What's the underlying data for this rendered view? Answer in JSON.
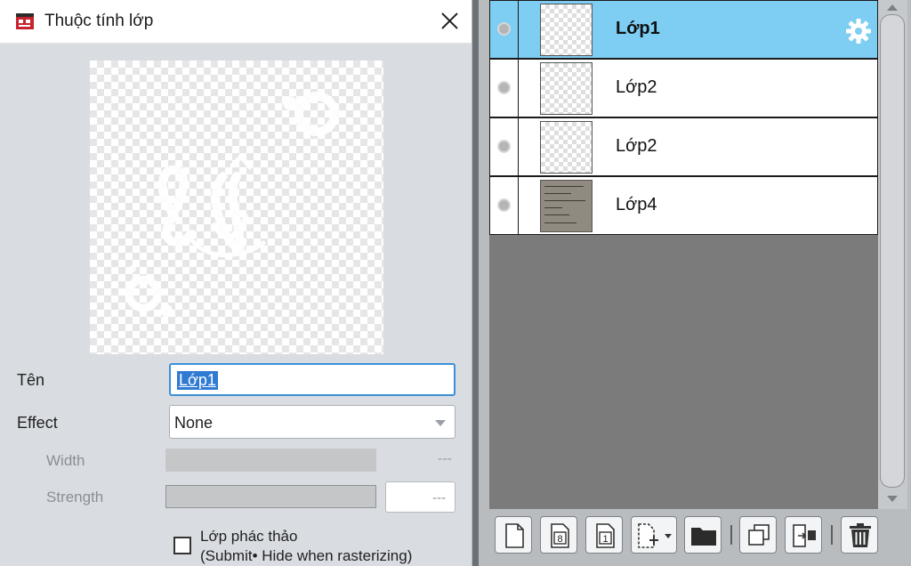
{
  "dialog": {
    "title": "Thuộc tính lớp",
    "name_label": "Tên",
    "name_value": "Lớp1",
    "effect_label": "Effect",
    "effect_value": "None",
    "width_label": "Width",
    "width_value": "---",
    "strength_label": "Strength",
    "strength_value": "---",
    "draft_label": "Lớp phác thảo",
    "draft_note": "(Submit• Hide when rasterizing)",
    "draft_checked": false
  },
  "layers": [
    {
      "name": "Lớp1",
      "selected": true,
      "thumb": "transparent"
    },
    {
      "name": "Lớp2",
      "selected": false,
      "thumb": "transparent"
    },
    {
      "name": "Lớp2",
      "selected": false,
      "thumb": "transparent"
    },
    {
      "name": "Lớp4",
      "selected": false,
      "thumb": "photo"
    }
  ],
  "toolbar": {
    "icons": [
      "new-layer-icon",
      "new-8bit-layer-icon",
      "new-1bit-layer-icon",
      "add-layer-dropdown-icon",
      "new-folder-icon",
      "duplicate-layer-icon",
      "merge-down-icon",
      "delete-layer-icon"
    ],
    "counter_8": "8",
    "counter_1": "1"
  },
  "colors": {
    "selected_row": "#7ecdf2",
    "input_focus_border": "#3c8fd8",
    "selection_highlight": "#2f7bd3",
    "panel_gray": "#7b7b7b"
  }
}
